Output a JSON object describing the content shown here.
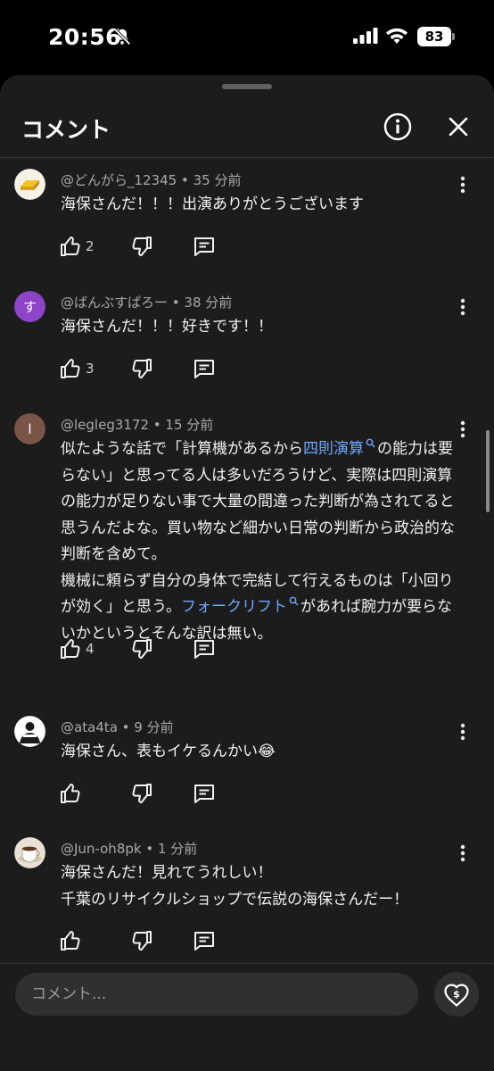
{
  "status_bar": {
    "time": "20:56",
    "battery_level": "83"
  },
  "header": {
    "title": "コメント"
  },
  "comments": [
    {
      "author": "@どんがら_12345",
      "time_ago": "35 分前",
      "segments": [
        {
          "text": "海保さんだ！！！出演ありがとうございます",
          "link": false
        }
      ],
      "likes": "2",
      "avatar_type": "gold"
    },
    {
      "author": "@ばんぶすぱろー",
      "time_ago": "38 分前",
      "segments": [
        {
          "text": "海保さんだ！！！好きです！！",
          "link": false
        }
      ],
      "likes": "3",
      "avatar_type": "letter",
      "avatar_letter": "す",
      "avatar_color": "#8e44c7"
    },
    {
      "author": "@legleg3172",
      "time_ago": "15 分前",
      "segments": [
        {
          "text": "似たような話で「計算機があるから",
          "link": false
        },
        {
          "text": "四則演算",
          "link": true
        },
        {
          "text": "の能力は要らない」と思ってる人は多いだろうけど、実際は四則演算の能力が足りない事で大量の間違った判断が為されてると思うんだよな。買い物など細かい日常の判断から政治的な判断を含めて。\n機械に頼らず自分の身体で完結して行えるものは「小回りが効く」と思う。",
          "link": false
        },
        {
          "text": "フォークリフト",
          "link": true
        },
        {
          "text": "があれば腕力が要らないかというとそんな訳は無い。",
          "link": false
        }
      ],
      "likes": "4",
      "avatar_type": "letter",
      "avatar_letter": "l",
      "avatar_color": "#7a5547"
    },
    {
      "author": "@ata4ta",
      "time_ago": "9 分前",
      "segments": [
        {
          "text": "海保さん、表もイケるんかい😂",
          "link": false
        }
      ],
      "likes": "",
      "avatar_type": "dark"
    },
    {
      "author": "@Jun-oh8pk",
      "time_ago": "1 分前",
      "segments": [
        {
          "text": "海保さんだ！見れてうれしい！\n千葉のリサイクルショップで伝説の海保さんだー！",
          "link": false
        }
      ],
      "likes": "",
      "avatar_type": "cup"
    }
  ],
  "meta_separator": " • ",
  "input": {
    "placeholder": "コメント..."
  },
  "colors": {
    "sheet_bg": "#1c1c1c",
    "link": "#6ea8ff",
    "meta": "#a9a9a9",
    "input_bg": "#303030"
  },
  "icons": {
    "header": [
      "info-icon",
      "close-icon"
    ],
    "actions": [
      "thumb-up-icon",
      "thumb-down-icon",
      "reply-icon",
      "more-vert-icon"
    ],
    "bottom": [
      "super-thanks-icon"
    ]
  }
}
